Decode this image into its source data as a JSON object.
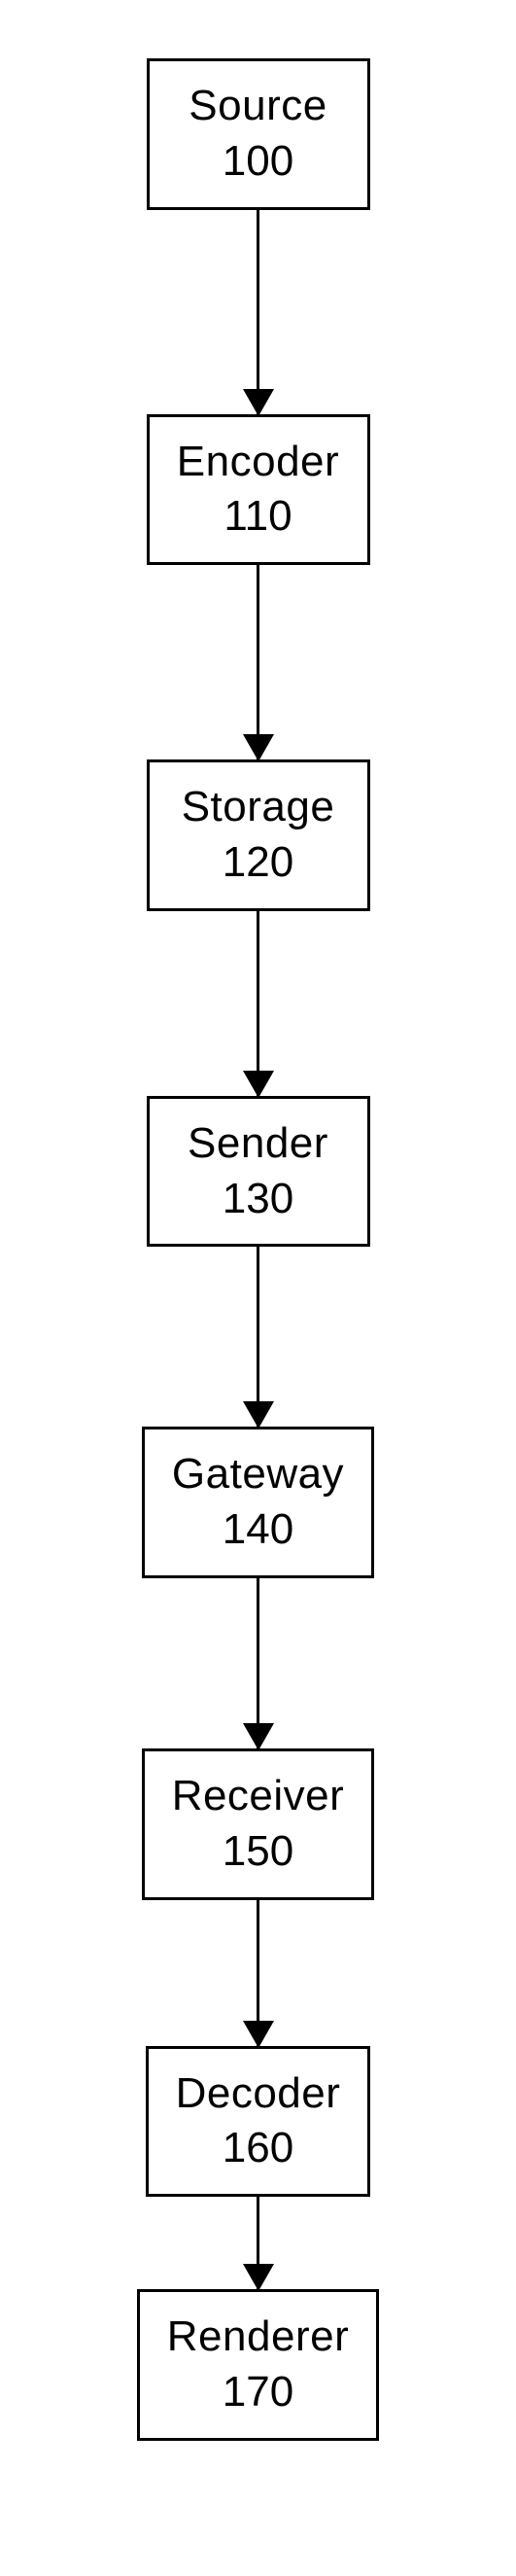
{
  "chart_data": {
    "type": "flow",
    "direction": "top-to-bottom",
    "nodes": [
      {
        "id": "source",
        "label": "Source",
        "number": "100"
      },
      {
        "id": "encoder",
        "label": "Encoder",
        "number": "110"
      },
      {
        "id": "storage",
        "label": "Storage",
        "number": "120"
      },
      {
        "id": "sender",
        "label": "Sender",
        "number": "130"
      },
      {
        "id": "gateway",
        "label": "Gateway",
        "number": "140"
      },
      {
        "id": "receiver",
        "label": "Receiver",
        "number": "150"
      },
      {
        "id": "decoder",
        "label": "Decoder",
        "number": "160"
      },
      {
        "id": "renderer",
        "label": "Renderer",
        "number": "170"
      }
    ],
    "edges": [
      {
        "from": "source",
        "to": "encoder",
        "length": 210
      },
      {
        "from": "encoder",
        "to": "storage",
        "length": 200
      },
      {
        "from": "storage",
        "to": "sender",
        "length": 190
      },
      {
        "from": "sender",
        "to": "gateway",
        "length": 185
      },
      {
        "from": "gateway",
        "to": "receiver",
        "length": 175
      },
      {
        "from": "receiver",
        "to": "decoder",
        "length": 150
      },
      {
        "from": "decoder",
        "to": "renderer",
        "length": 95
      }
    ]
  }
}
